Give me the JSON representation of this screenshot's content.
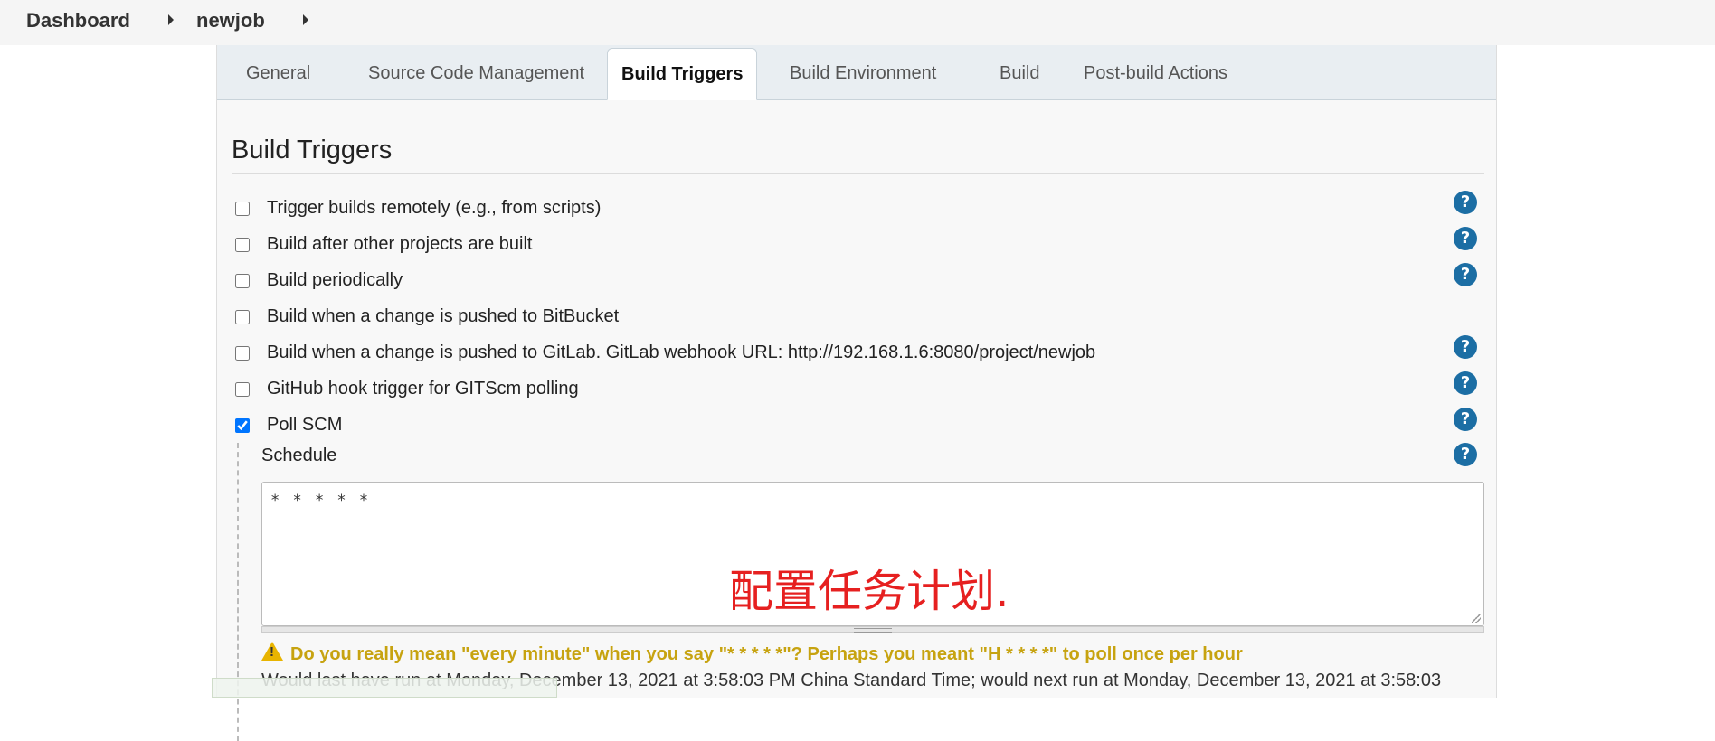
{
  "breadcrumb": {
    "items": [
      "Dashboard",
      "newjob"
    ]
  },
  "tabs": [
    {
      "label": "General",
      "active": false
    },
    {
      "label": "Source Code Management",
      "active": false
    },
    {
      "label": "Build Triggers",
      "active": true
    },
    {
      "label": "Build Environment",
      "active": false
    },
    {
      "label": "Build",
      "active": false
    },
    {
      "label": "Post-build Actions",
      "active": false
    }
  ],
  "section": {
    "title": "Build Triggers"
  },
  "triggers": [
    {
      "label": "Trigger builds remotely (e.g., from scripts)",
      "checked": false,
      "help": true
    },
    {
      "label": "Build after other projects are built",
      "checked": false,
      "help": true
    },
    {
      "label": "Build periodically",
      "checked": false,
      "help": true
    },
    {
      "label": "Build when a change is pushed to BitBucket",
      "checked": false,
      "help": false
    },
    {
      "label": "Build when a change is pushed to GitLab. GitLab webhook URL: http://192.168.1.6:8080/project/newjob",
      "checked": false,
      "help": true
    },
    {
      "label": "GitHub hook trigger for GITScm polling",
      "checked": false,
      "help": true
    },
    {
      "label": "Poll SCM",
      "checked": true,
      "help": true
    }
  ],
  "schedule": {
    "label": "Schedule",
    "value": "* * * * *",
    "annotation": "配置任务计划.",
    "warning": "Do you really mean \"every minute\" when you say \"* * * * *\"? Perhaps you meant \"H * * * *\" to poll once per hour",
    "run_info": "Would last have run at Monday, December 13, 2021 at 3:58:03 PM China Standard Time; would next run at Monday, December 13, 2021 at 3:58:03"
  },
  "help_glyph": "?",
  "colors": {
    "help": "#1c6ea4",
    "warning": "#c7a310",
    "annotation": "#e62020"
  }
}
